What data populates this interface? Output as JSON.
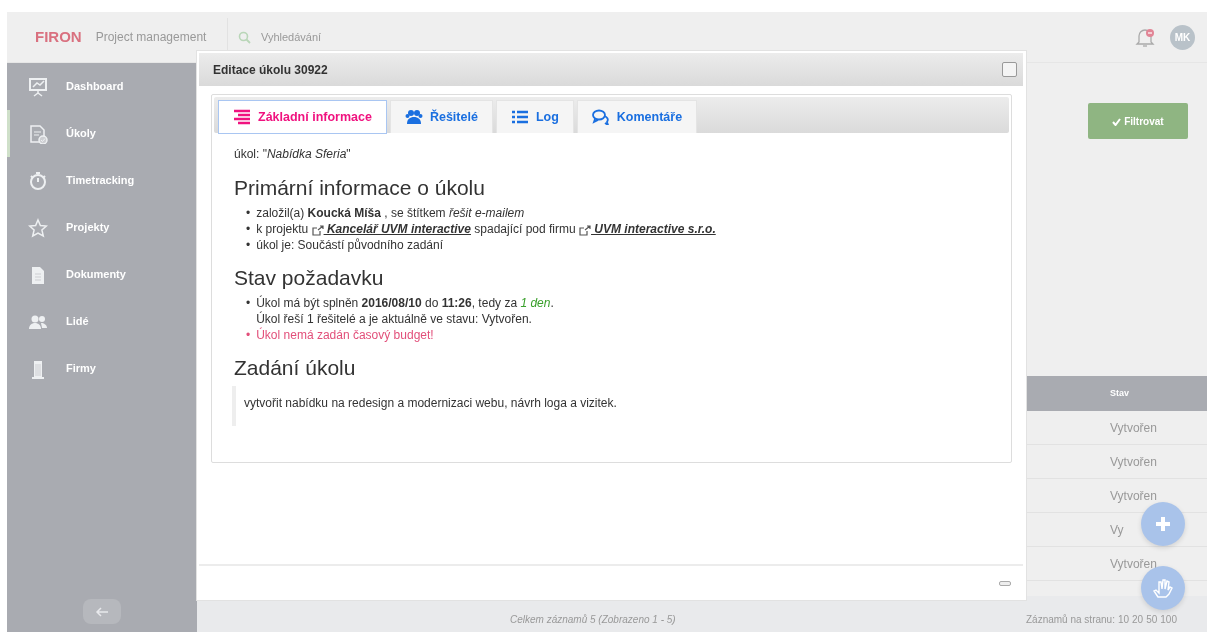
{
  "header": {
    "logo": "FIRON",
    "subtitle": "Project management",
    "search": {
      "placeholder": "Vyhledávání"
    },
    "avatar": "MK"
  },
  "sidebar": {
    "items": [
      {
        "label": "Dashboard",
        "selected": false
      },
      {
        "label": "Úkoly",
        "selected": true
      },
      {
        "label": "Timetracking",
        "selected": false
      },
      {
        "label": "Projekty",
        "selected": false
      },
      {
        "label": "Dokumenty",
        "selected": false
      },
      {
        "label": "Lidé",
        "selected": false
      },
      {
        "label": "Firmy",
        "selected": false
      }
    ]
  },
  "filter_button": "Filtrovat",
  "table": {
    "columns": [
      "Stav"
    ],
    "rows": [
      {
        "status": "Vytvořen"
      },
      {
        "status": "Vytvořen"
      },
      {
        "status": "Vytvořen"
      },
      {
        "status": "Vy"
      },
      {
        "status": "Vytvořen"
      }
    ]
  },
  "record_count": "Celkem záznamů 5 (Zobrazeno 1 - 5)",
  "page_size": {
    "label": "Záznamů na stranu:",
    "options": [
      "10",
      "20",
      "50",
      "100"
    ]
  },
  "modal": {
    "title": "Editace úkolu 30922",
    "tabs": [
      {
        "label": "Základní informace",
        "selected": true
      },
      {
        "label": "Řešitelé",
        "selected": false
      },
      {
        "label": "Log",
        "selected": false
      },
      {
        "label": "Komentáře",
        "selected": false
      }
    ],
    "task_line": "úkol: \"*Nabídka Sferia*\"",
    "sections": [
      {
        "heading": "Primární informace o úkolu",
        "items": [
          {
            "kind": "plain",
            "marker": "•",
            "parts": [
              {
                "kind": "text",
                "text": "založil(a) **Koucká Míša** , se štítkem *řešit e-mailem*"
              }
            ]
          },
          {
            "kind": "plain",
            "marker": "•",
            "parts": [
              {
                "kind": "text",
                "text": "k projektu "
              },
              {
                "kind": "link",
                "text": " Kancelář UVM interactive"
              },
              {
                "kind": "text",
                "text": " spadající pod firmu "
              },
              {
                "kind": "link",
                "text": " UVM interactive s.r.o."
              }
            ]
          },
          {
            "kind": "plain",
            "marker": "•",
            "parts": [
              {
                "kind": "text",
                "text": "úkol je: Součástí původního zadání"
              }
            ]
          }
        ]
      },
      {
        "heading": "Stav požadavku",
        "items": [
          {
            "kind": "plain",
            "marker": "•",
            "parts": [
              {
                "kind": "text",
                "text": "Úkol má být splněn **2016/08/10** do **11:26**, tedy za "
              },
              {
                "kind": "success",
                "text": "1 den"
              },
              {
                "kind": "text",
                "text": "."
              },
              {
                "kind": "line",
                "text": "Úkol řeší 1 řešitelé a je aktuálně ve stavu: Vytvořen."
              }
            ]
          },
          {
            "kind": "warning",
            "marker": "•",
            "parts": [
              {
                "kind": "text",
                "text": "Úkol nemá zadán časový budget!"
              }
            ]
          }
        ]
      },
      {
        "heading": "Zadání úkolu",
        "quote": "vytvořit nabídku na redesign a modernizaci webu, návrh loga a vizitek."
      }
    ]
  }
}
